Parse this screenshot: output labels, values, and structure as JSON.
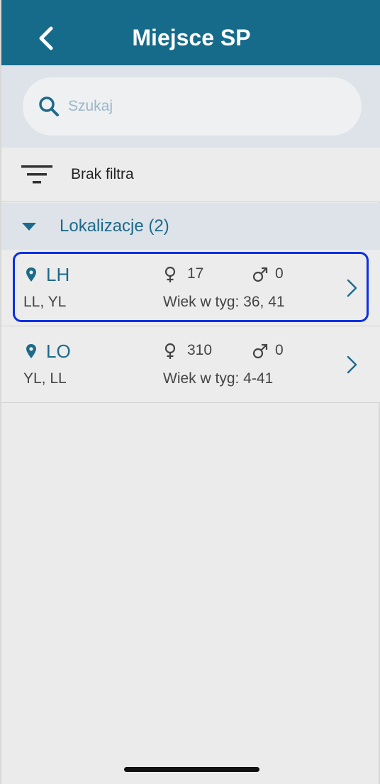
{
  "header": {
    "title": "Miejsce SP"
  },
  "search": {
    "placeholder": "Szukaj"
  },
  "filter": {
    "label": "Brak filtra"
  },
  "section": {
    "label": "Lokalizacje (2)"
  },
  "items": [
    {
      "name": "LH",
      "sub": "LL, YL",
      "female": "17",
      "male": "0",
      "age": "Wiek w tyg: 36, 41",
      "selected": true
    },
    {
      "name": "LO",
      "sub": "YL, LL",
      "female": "310",
      "male": "0",
      "age": "Wiek w tyg: 4-41",
      "selected": false
    }
  ],
  "colors": {
    "header": "#176b8a",
    "accent": "#1d6a8a",
    "selection": "#0a2fe6"
  }
}
